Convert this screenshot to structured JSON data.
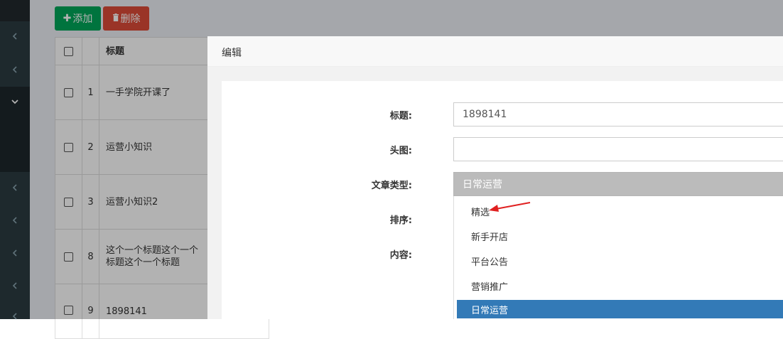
{
  "toolbar": {
    "add_label": "添加",
    "delete_label": "删除"
  },
  "table": {
    "header_title": "标题",
    "rows": [
      {
        "id": "1",
        "title": "一手学院开课了"
      },
      {
        "id": "2",
        "title": "运营小知识"
      },
      {
        "id": "3",
        "title": "运营小知识2"
      },
      {
        "id": "8",
        "title": "这个一个标题这个一个标题这个一个标题"
      },
      {
        "id": "9",
        "title": "1898141"
      }
    ]
  },
  "modal": {
    "title": "编辑",
    "fields": {
      "title_label": "标题:",
      "title_value": "1898141",
      "image_label": "头图:",
      "image_value": "",
      "type_label": "文章类型:",
      "type_value": "日常运营",
      "sort_label": "排序:",
      "content_label": "内容:"
    },
    "type_options": [
      "精选",
      "新手开店",
      "平台公告",
      "营销推广",
      "日常运营"
    ],
    "selected_option_index": 4
  },
  "colors": {
    "sidebar": "#2c3b41",
    "add_button": "#00a65a",
    "delete_button": "#dd4b39",
    "selected_option": "#337ab7",
    "annotation_arrow": "#e02020"
  },
  "icons": {
    "sidebar": [
      "chevron-left-icon",
      "chevron-left-icon",
      "chevron-down-icon",
      "chevron-left-icon",
      "chevron-left-icon",
      "chevron-left-icon",
      "chevron-left-icon",
      "chevron-left-icon"
    ],
    "add": "plus-icon",
    "delete": "trash-icon",
    "annotation": "red-arrow-icon"
  }
}
